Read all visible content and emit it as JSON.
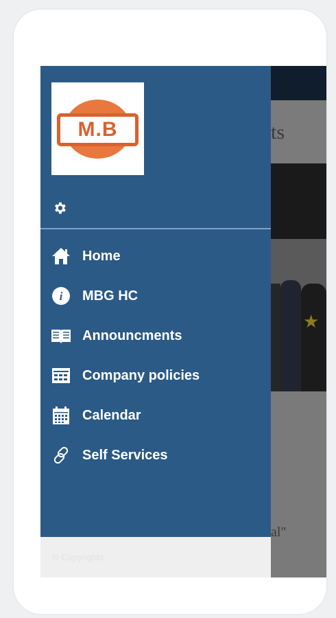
{
  "background_app": {
    "header_fragment": "ts",
    "quote_fragment": "al\""
  },
  "drawer": {
    "logo_text": "M.B",
    "settings_icon": "gear-icon",
    "menu": [
      {
        "label": "Home",
        "icon": "home-icon"
      },
      {
        "label": "MBG HC",
        "icon": "info-icon"
      },
      {
        "label": "Announcments",
        "icon": "book-icon"
      },
      {
        "label": "Company policies",
        "icon": "table-icon"
      },
      {
        "label": "Calendar",
        "icon": "calendar-icon"
      },
      {
        "label": "Self Services",
        "icon": "link-icon"
      }
    ],
    "footer": "© Copyrights"
  },
  "colors": {
    "drawer_bg": "#2b5a86",
    "logo_orange": "#d9622e",
    "footer_bg": "#efefef"
  }
}
